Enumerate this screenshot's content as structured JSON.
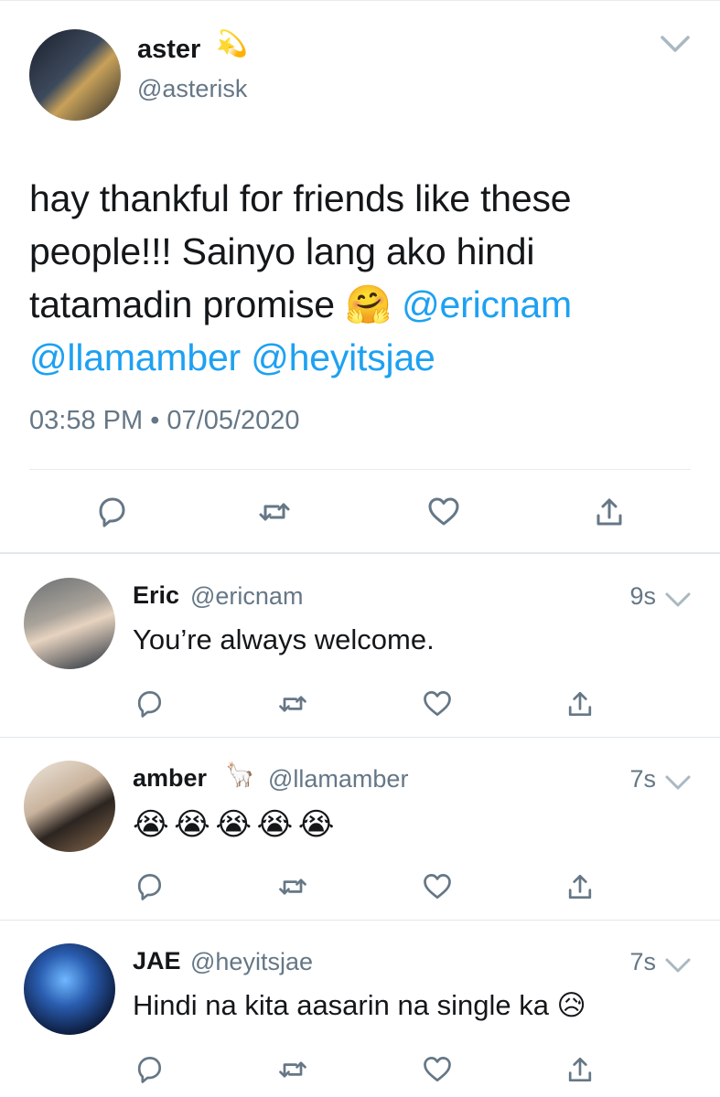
{
  "main_tweet": {
    "name": "aster",
    "name_emoji": "💫",
    "handle": "@asterisk",
    "text_plain": "hay thankful for friends like these people!!! Sainyo lang ako hindi tatamadin promise 🤗 ",
    "mentions": [
      "@ericnam",
      "@llamamber",
      "@heyitsjae"
    ],
    "time": "03:58 PM",
    "dot": "•",
    "date": "07/05/2020"
  },
  "replies": [
    {
      "name": "Eric",
      "emoji": "",
      "handle": "@ericnam",
      "time": "9s",
      "text": "You’re always welcome."
    },
    {
      "name": "amber",
      "emoji": "🦙",
      "handle": "@llamamber",
      "time": "7s",
      "text": "😭 😭 😭 😭 😭"
    },
    {
      "name": "JAE",
      "emoji": "",
      "handle": "@heyitsjae",
      "time": "7s",
      "text": "Hindi na kita aasarin na single ka 😥"
    }
  ],
  "icons": {
    "reply": "reply-icon",
    "retweet": "retweet-icon",
    "like": "like-icon",
    "share": "share-icon",
    "more": "chevron-down-icon"
  },
  "colors": {
    "mention": "#1da1f2",
    "secondary_text": "#657786",
    "icon": "#657786",
    "divider": "#e6ecf0"
  }
}
